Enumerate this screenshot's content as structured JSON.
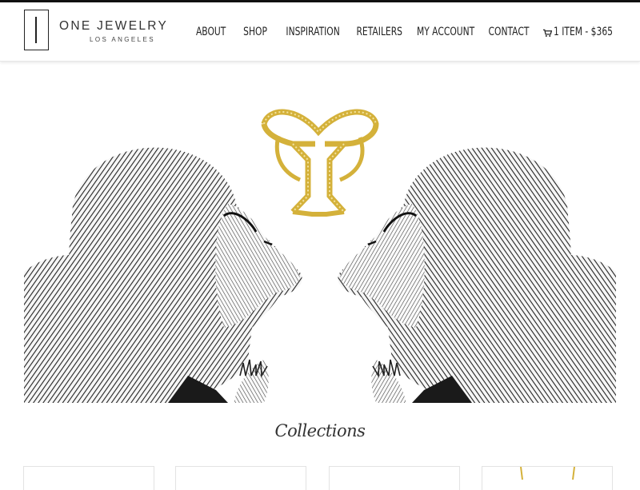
{
  "brand": {
    "name": "ONE JEWELRY",
    "subtitle": "LOS ANGELES"
  },
  "nav": {
    "items": [
      {
        "label": "ABOUT"
      },
      {
        "label": "SHOP"
      },
      {
        "label": "INSPIRATION"
      },
      {
        "label": "RETAILERS"
      },
      {
        "label": "MY ACCOUNT"
      },
      {
        "label": "CONTACT"
      }
    ],
    "cart_label": "1 ITEM - $365"
  },
  "hero": {
    "image": "two-lions-with-gold-ring"
  },
  "section": {
    "title": "Collections"
  },
  "collections": {
    "card_count": 4
  },
  "icons": {
    "cart": "cart-icon"
  },
  "colors": {
    "accent_gold": "#d4b13a",
    "text": "#222222",
    "header_bar": "#111111"
  }
}
